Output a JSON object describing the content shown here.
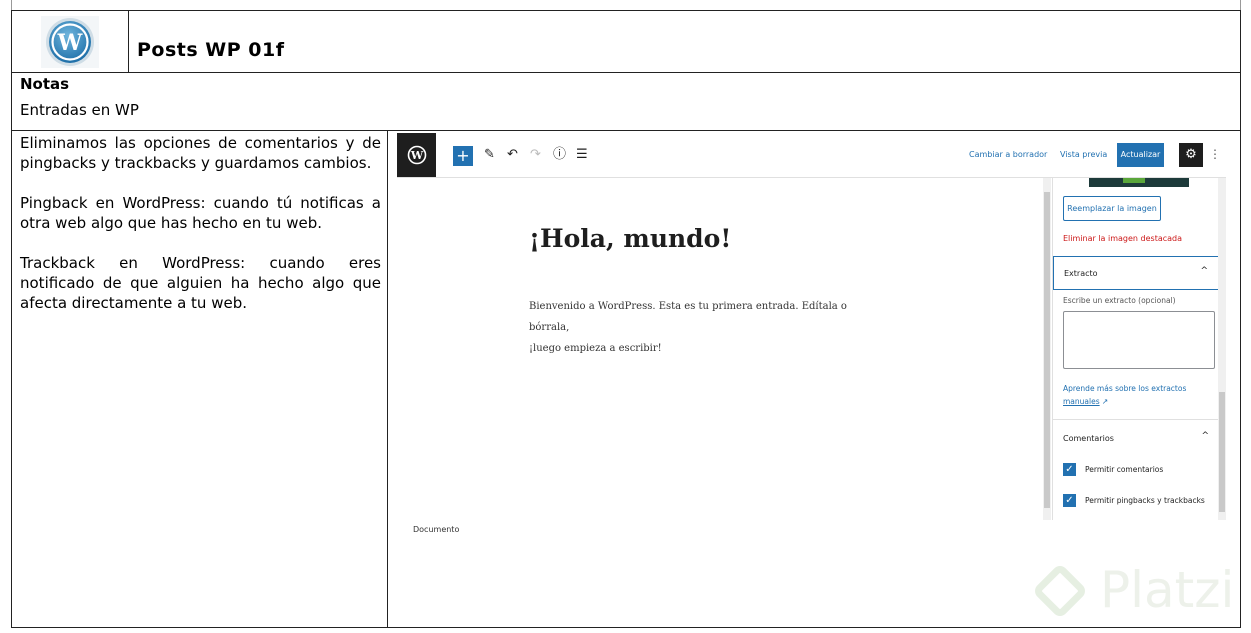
{
  "document": {
    "title": "Posts WP 01f",
    "notes_label": "Notas",
    "notes_text": "Entradas en WP",
    "paragraphs": [
      "Eliminamos las opciones de comentarios y de pingbacks y trackbacks y guardamos cambios.",
      "Pingback en WordPress: cuando tú notificas a otra web algo que has hecho en tu web.",
      "Trackback en WordPress: cuando eres notificado de que alguien ha hecho algo que afecta directamente a tu web."
    ]
  },
  "editor": {
    "toolbar": {
      "switch_draft": "Cambiar a borrador",
      "preview": "Vista previa",
      "update": "Actualizar"
    },
    "post": {
      "title": "¡Hola, mundo!",
      "body_line1": "Bienvenido a WordPress. Esta es tu primera entrada. Edítala o bórrala,",
      "body_line2": "¡luego empieza a escribir!"
    },
    "footer_label": "Documento",
    "sidebar": {
      "replace_image": "Reemplazar la imagen",
      "remove_image": "Eliminar la imagen destacada",
      "excerpt_panel": "Extracto",
      "excerpt_hint": "Escribe un extracto (opcional)",
      "learn_more_1": "Aprende más sobre los extractos",
      "learn_more_2": "manuales",
      "comments_panel": "Comentarios",
      "allow_comments": "Permitir comentarios",
      "allow_pingbacks": "Permitir pingbacks y trackbacks"
    }
  },
  "watermark": "Platzi",
  "colors": {
    "wp_blue": "#2271b1",
    "wp_dark": "#1e1e1e",
    "danger": "#cc1818"
  }
}
